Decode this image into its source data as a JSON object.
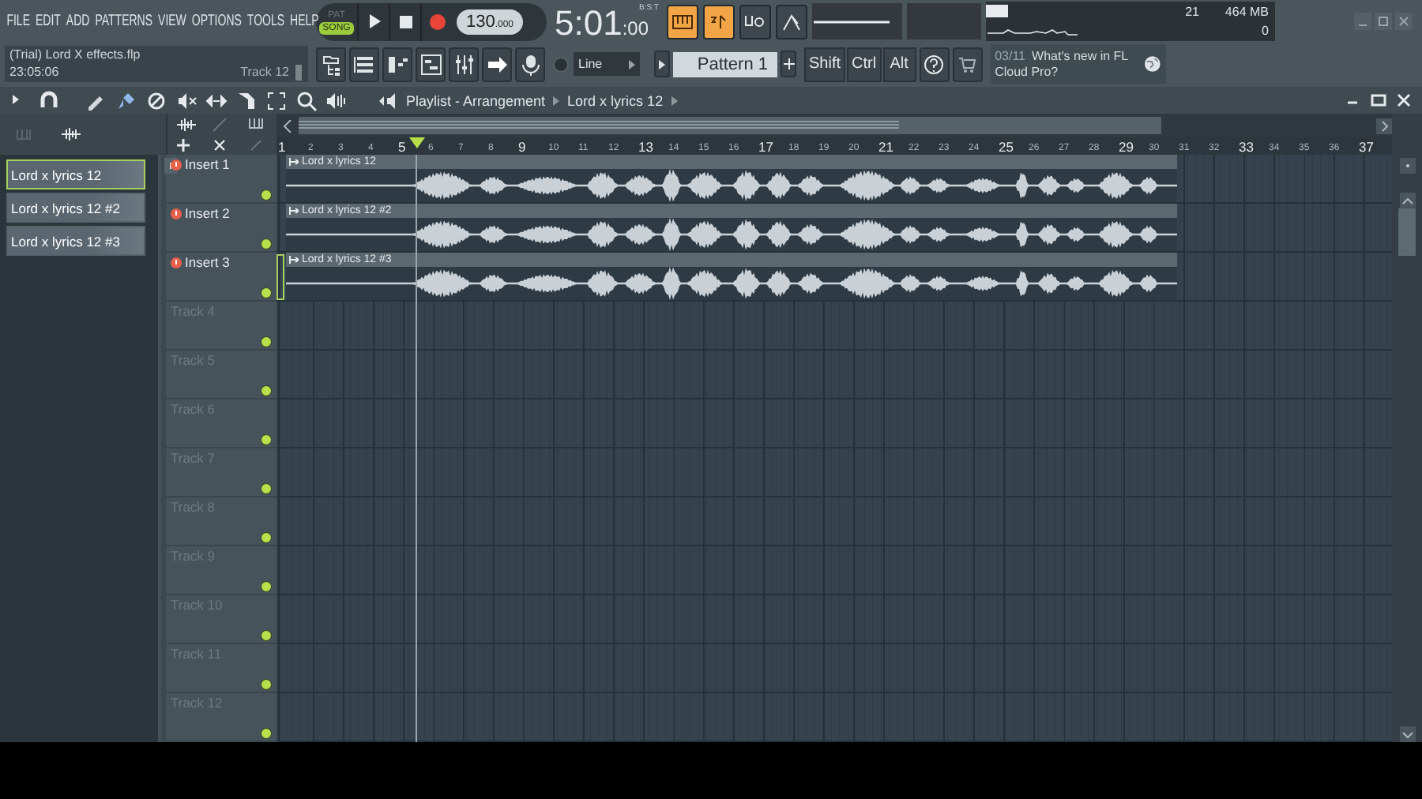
{
  "menu": [
    "FILE",
    "EDIT",
    "ADD",
    "PATTERNS",
    "VIEW",
    "OPTIONS",
    "TOOLS",
    "HELP"
  ],
  "modes": [
    {
      "label": "PAT",
      "selected": false
    },
    {
      "label": "SONG",
      "selected": true
    }
  ],
  "tempo": {
    "whole": "130",
    "fraction": ".000"
  },
  "song_time": {
    "main": "5:01",
    "ticks": ":00",
    "format": "B:S:T"
  },
  "toggles": [
    {
      "kind": "keyboard",
      "on": true
    },
    {
      "kind": "countdown",
      "on": true
    },
    {
      "kind": "blend",
      "on": false
    },
    {
      "kind": "metronome",
      "on": false
    }
  ],
  "monitor": {
    "polyphony": "21",
    "memory": "464 MB",
    "cpu": "0"
  },
  "hint_panel": {
    "project": "(Trial) Lord X effects.flp",
    "time": "23:05:06",
    "target": "Track 12"
  },
  "snap": "Line",
  "pattern": "Pattern 1",
  "modifier_keys": [
    "Shift",
    "Ctrl",
    "Alt"
  ],
  "news": {
    "date": "03/11",
    "text": "What's new in FL Cloud Pro?"
  },
  "playlist": {
    "title": "Playlist - Arrangement",
    "current_clip": "Lord x lyrics 12",
    "clip_list": [
      {
        "name": "Lord x lyrics 12",
        "selected": true
      },
      {
        "name": "Lord x lyrics 12 #2",
        "selected": false
      },
      {
        "name": "Lord x lyrics 12 #3",
        "selected": false
      }
    ],
    "ruler": [
      "1",
      "2",
      "3",
      "4",
      "5",
      "6",
      "7",
      "8",
      "9",
      "10",
      "11",
      "12",
      "13",
      "14",
      "15",
      "16",
      "17",
      "18",
      "19",
      "20",
      "21",
      "22",
      "23",
      "24",
      "25",
      "26",
      "27",
      "28",
      "29",
      "30",
      "31",
      "32",
      "33",
      "34",
      "35",
      "36",
      "37"
    ],
    "tracks": [
      {
        "name": "Insert 1",
        "kind": "audio",
        "enabled": true,
        "selected": false,
        "clip": "Lord x lyrics 12"
      },
      {
        "name": "Insert 2",
        "kind": "audio",
        "enabled": true,
        "selected": false,
        "clip": "Lord x lyrics 12 #2"
      },
      {
        "name": "Insert 3",
        "kind": "audio",
        "enabled": true,
        "selected": true,
        "clip": "Lord x lyrics 12 #3"
      },
      {
        "name": "Track 4",
        "kind": "empty",
        "enabled": true,
        "selected": false
      },
      {
        "name": "Track 5",
        "kind": "empty",
        "enabled": true,
        "selected": false
      },
      {
        "name": "Track 6",
        "kind": "empty",
        "enabled": true,
        "selected": false
      },
      {
        "name": "Track 7",
        "kind": "empty",
        "enabled": true,
        "selected": false
      },
      {
        "name": "Track 8",
        "kind": "empty",
        "enabled": true,
        "selected": false
      },
      {
        "name": "Track 9",
        "kind": "empty",
        "enabled": true,
        "selected": false
      },
      {
        "name": "Track 10",
        "kind": "empty",
        "enabled": true,
        "selected": false
      },
      {
        "name": "Track 11",
        "kind": "empty",
        "enabled": true,
        "selected": false
      },
      {
        "name": "Track 12",
        "kind": "empty",
        "enabled": true,
        "selected": false
      }
    ]
  }
}
